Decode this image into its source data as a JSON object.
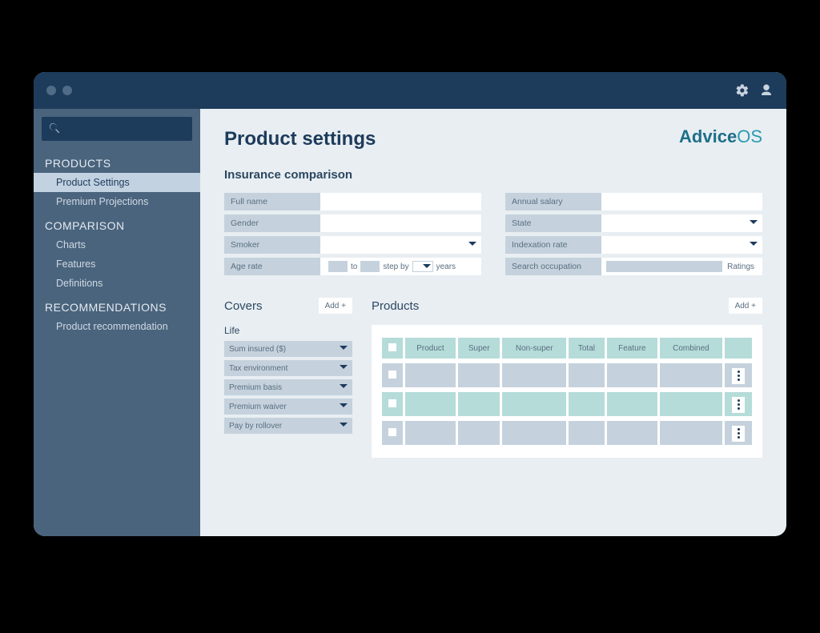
{
  "brand": {
    "part1": "Advice",
    "part2": "OS"
  },
  "sidebar": {
    "groups": [
      {
        "heading": "PRODUCTS",
        "items": [
          "Product Settings",
          "Premium Projections"
        ],
        "active": 0
      },
      {
        "heading": "COMPARISON",
        "items": [
          "Charts",
          "Features",
          "Definitions"
        ]
      },
      {
        "heading": "RECOMMENDATIONS",
        "items": [
          "Product recommendation"
        ]
      }
    ],
    "search_placeholder": ""
  },
  "page": {
    "title": "Product settings",
    "section": "Insurance comparison"
  },
  "form": {
    "left": [
      {
        "label": "Full name",
        "type": "text"
      },
      {
        "label": "Gender",
        "type": "text"
      },
      {
        "label": "Smoker",
        "type": "select"
      },
      {
        "label": "Age rate",
        "type": "agerate",
        "to": "to",
        "step": "step by",
        "years": "years"
      }
    ],
    "right": [
      {
        "label": "Annual salary",
        "type": "text"
      },
      {
        "label": "State",
        "type": "select"
      },
      {
        "label": "Indexation rate",
        "type": "select"
      },
      {
        "label": "Search occupation",
        "type": "occupation",
        "ratings": "Ratings"
      }
    ]
  },
  "covers": {
    "title": "Covers",
    "add": "Add +",
    "sub": "Life",
    "items": [
      "Sum insured ($)",
      "Tax environment",
      "Premium basis",
      "Premium waiver",
      "Pay by rollover"
    ]
  },
  "products": {
    "title": "Products",
    "add": "Add +",
    "columns": [
      "Product",
      "Super",
      "Non-super",
      "Total",
      "Feature",
      "Combined"
    ],
    "rows": 3
  }
}
